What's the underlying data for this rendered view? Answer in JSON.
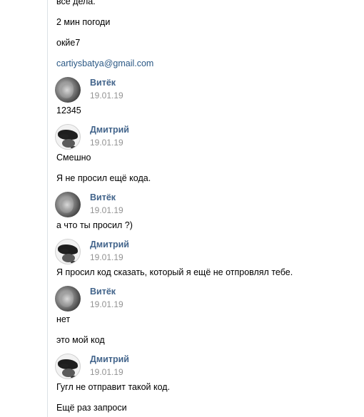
{
  "messages_top": [
    {
      "text": "все дела."
    },
    {
      "text": "2 мин погоди"
    },
    {
      "text": "окйе7"
    },
    {
      "text": "cartiysbatya@gmail.com",
      "is_link": true
    }
  ],
  "groups": [
    {
      "author": "Витёк",
      "date": "19.01.19",
      "avatar": "vitek-avatar",
      "lines": [
        "12345"
      ]
    },
    {
      "author": "Дмитрий",
      "date": "19.01.19",
      "avatar": "dmitry-avatar",
      "lines": [
        "Смешно",
        "Я не просил ещё кода."
      ]
    },
    {
      "author": "Витёк",
      "date": "19.01.19",
      "avatar": "vitek-avatar",
      "lines": [
        "а что ты просил ?)"
      ]
    },
    {
      "author": "Дмитрий",
      "date": "19.01.19",
      "avatar": "dmitry-avatar",
      "lines": [
        "Я просил код сказать, который я ещё не отпровлял тебе."
      ]
    },
    {
      "author": "Витёк",
      "date": "19.01.19",
      "avatar": "vitek-avatar",
      "lines": [
        "нет",
        "это мой код"
      ]
    },
    {
      "author": "Дмитрий",
      "date": "19.01.19",
      "avatar": "dmitry-avatar",
      "lines": [
        "Гугл не отправит такой код.",
        "Ещё раз запроси"
      ]
    }
  ],
  "colors": {
    "author": "#42648b",
    "date": "#939393",
    "link": "#2a5885",
    "divider": "#dce1e6"
  }
}
